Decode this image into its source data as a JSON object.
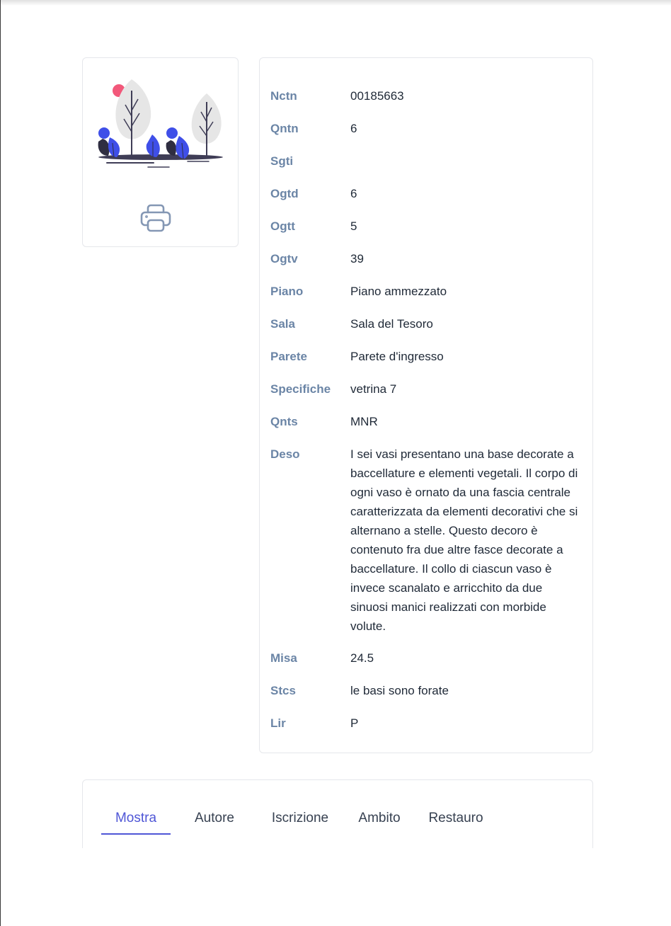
{
  "record": {
    "fields": [
      {
        "label": "Nctn",
        "value": "00185663"
      },
      {
        "label": "Qntn",
        "value": "6"
      },
      {
        "label": "Sgti",
        "value": ""
      },
      {
        "label": "Ogtd",
        "value": "6"
      },
      {
        "label": "Ogtt",
        "value": "5"
      },
      {
        "label": "Ogtv",
        "value": "39"
      },
      {
        "label": "Piano",
        "value": "Piano ammezzato"
      },
      {
        "label": "Sala",
        "value": "Sala del Tesoro"
      },
      {
        "label": "Parete",
        "value": "Parete d'ingresso"
      },
      {
        "label": "Specifiche",
        "value": "vetrina 7"
      },
      {
        "label": "Qnts",
        "value": "MNR"
      },
      {
        "label": "Deso",
        "value": "I sei vasi presentano una base decorate a baccellature e elementi vegetali. Il corpo di ogni vaso è ornato da una fascia centrale caratterizzata da elementi decorativi che si alternano a stelle. Questo decoro è contenuto fra due altre fasce decorate a baccellature. Il collo di ciascun vaso è invece scanalato e arricchito da due sinuosi manici realizzati con morbide volute."
      },
      {
        "label": "Misa",
        "value": "24.5"
      },
      {
        "label": "Stcs",
        "value": "le basi sono forate"
      },
      {
        "label": "Lir",
        "value": "P"
      }
    ]
  },
  "image_card": {
    "illustration_icon": "trees-placeholder-illustration",
    "print_icon": "printer-icon"
  },
  "tabs": [
    {
      "label": "Mostra",
      "active": true
    },
    {
      "label": "Autore",
      "active": false
    },
    {
      "label": "Iscrizione",
      "active": false
    },
    {
      "label": "Ambito",
      "active": false
    },
    {
      "label": "Restauro",
      "active": false
    }
  ],
  "colors": {
    "label": "#6b85a6",
    "accent": "#4f56d6",
    "illustration_blue": "#3f4fe8",
    "illustration_pink": "#f2587a"
  }
}
